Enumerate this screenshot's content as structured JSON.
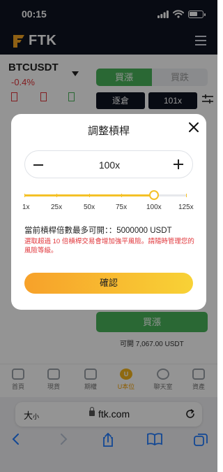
{
  "status_bar": {
    "time": "00:15"
  },
  "app": {
    "logo_text": "FTK"
  },
  "trade": {
    "pair": "BTCUSDT",
    "change": "-0.4%",
    "buy_tab": "買漲",
    "sell_tab": "買跌",
    "margin_mode": "逐倉",
    "leverage_btn": "101x",
    "buy_button": "買漲",
    "available": "可開 7,067.00 USDT"
  },
  "bottom_nav": {
    "items": [
      {
        "label": "首頁",
        "icon": "home-icon"
      },
      {
        "label": "現貨",
        "icon": "spot-icon"
      },
      {
        "label": "期權",
        "icon": "chart-icon"
      },
      {
        "label": "U本位",
        "icon": "u-coin-icon"
      },
      {
        "label": "聊天室",
        "icon": "chat-icon"
      },
      {
        "label": "資產",
        "icon": "wallet-icon"
      }
    ]
  },
  "browser": {
    "text_size": "大",
    "text_size_small": "小",
    "domain": "ftk.com"
  },
  "modal": {
    "title": "調整槓桿",
    "leverage_value": "100x",
    "slider_value_x": 100,
    "slider_max_x": 125,
    "ticks": [
      "1x",
      "25x",
      "50x",
      "75x",
      "100x",
      "125x"
    ],
    "max_text": "當前槓桿倍數最多可開：：5000000 USDT",
    "warning": "選取超過 10 倍槓桿交易會增加強平風險。請隨時管理您的風險等級。",
    "confirm": "確認"
  },
  "colors": {
    "accent": "#f4c127",
    "buy": "#49b35a",
    "sell": "#e0353a",
    "dark": "#0f1322"
  }
}
